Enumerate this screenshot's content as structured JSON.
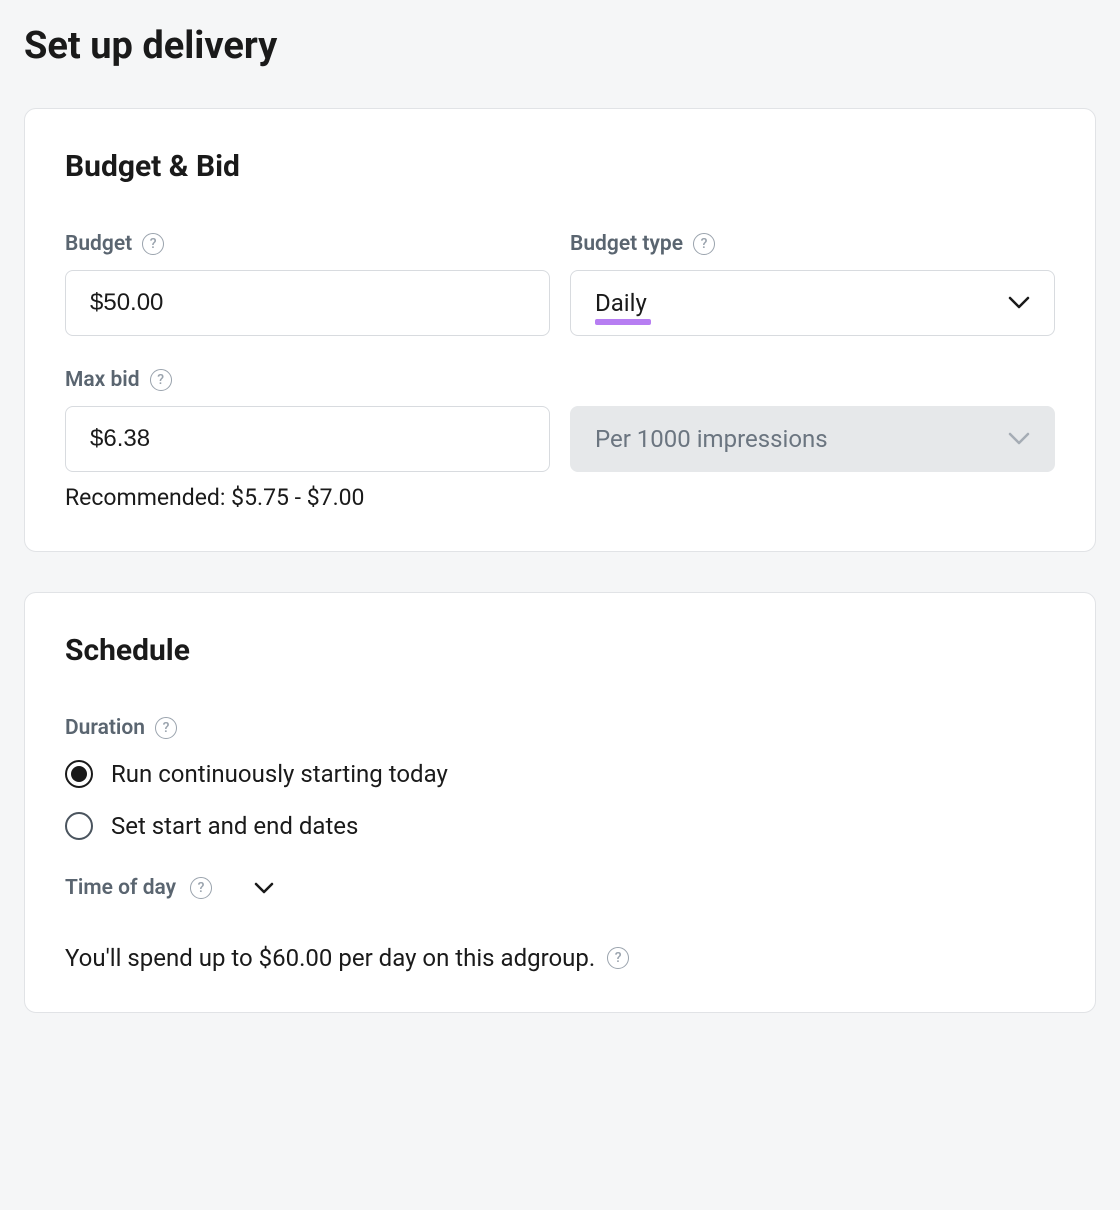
{
  "page": {
    "title": "Set up delivery"
  },
  "budget_bid": {
    "card_title": "Budget & Bid",
    "budget": {
      "label": "Budget",
      "value": "$50.00"
    },
    "budget_type": {
      "label": "Budget type",
      "selected": "Daily"
    },
    "max_bid": {
      "label": "Max bid",
      "value": "$6.38",
      "recommended": "Recommended: $5.75 - $7.00"
    },
    "bid_unit": {
      "selected": "Per 1000 impressions"
    }
  },
  "schedule": {
    "card_title": "Schedule",
    "duration": {
      "label": "Duration",
      "options": {
        "continuous": "Run continuously starting today",
        "set_dates": "Set start and end dates"
      }
    },
    "time_of_day": {
      "label": "Time of day"
    },
    "summary": "You'll spend up to $60.00 per day on this adgroup."
  }
}
